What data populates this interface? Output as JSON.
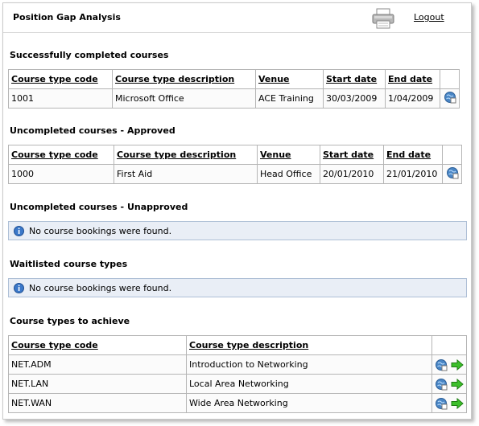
{
  "header": {
    "title": "Position Gap Analysis",
    "logout_label": "Logout"
  },
  "sections": {
    "completed": {
      "title": "Successfully completed courses",
      "columns": [
        "Course type code",
        "Course type description",
        "Venue",
        "Start date",
        "End date"
      ],
      "rows": [
        {
          "code": "1001",
          "description": "Microsoft Office",
          "venue": "ACE Training",
          "start": "30/03/2009",
          "end": "1/04/2009"
        }
      ]
    },
    "uncompleted_approved": {
      "title": "Uncompleted courses - Approved",
      "columns": [
        "Course type code",
        "Course type description",
        "Venue",
        "Start date",
        "End date"
      ],
      "rows": [
        {
          "code": "1000",
          "description": "First Aid",
          "venue": "Head Office",
          "start": "20/01/2010",
          "end": "21/01/2010"
        }
      ]
    },
    "uncompleted_unapproved": {
      "title": "Uncompleted courses - Unapproved",
      "message": "No course bookings were found."
    },
    "waitlisted": {
      "title": "Waitlisted course types",
      "message": "No course bookings were found."
    },
    "to_achieve": {
      "title": "Course types to achieve",
      "columns": [
        "Course type code",
        "Course type description"
      ],
      "rows": [
        {
          "code": "NET.ADM",
          "description": "Introduction to Networking"
        },
        {
          "code": "NET.LAN",
          "description": "Local Area Networking"
        },
        {
          "code": "NET.WAN",
          "description": "Wide Area Networking"
        }
      ]
    }
  },
  "icons": {
    "details": "globe-details-icon",
    "go": "green-arrow-icon",
    "info": "info-icon",
    "print": "printer-icon"
  },
  "colors": {
    "info_bg": "#e9eef6",
    "info_border": "#aebfd6",
    "arrow": "#3cbf2a",
    "globe": "#4a86c5"
  }
}
